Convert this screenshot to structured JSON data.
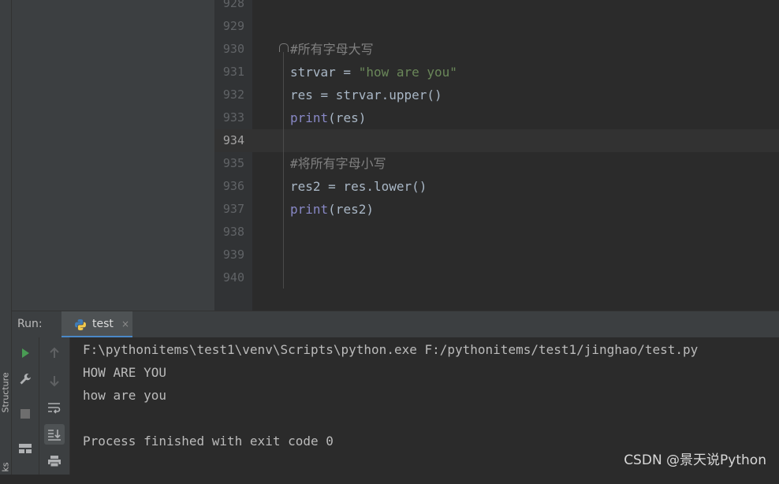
{
  "sidebar": {
    "structure_label": "Structure",
    "bookmarks_label": "ks"
  },
  "editor": {
    "lines": [
      {
        "num": "928",
        "tokens": []
      },
      {
        "num": "929",
        "tokens": []
      },
      {
        "num": "930",
        "tokens": [
          {
            "t": "#所有字母大写",
            "c": "comment"
          }
        ]
      },
      {
        "num": "931",
        "tokens": [
          {
            "t": "strvar = ",
            "c": ""
          },
          {
            "t": "\"how are you\"",
            "c": "kw-str"
          }
        ]
      },
      {
        "num": "932",
        "tokens": [
          {
            "t": "res = strvar.upper()",
            "c": ""
          }
        ]
      },
      {
        "num": "933",
        "tokens": [
          {
            "t": "print",
            "c": "kw-fn"
          },
          {
            "t": "(res)",
            "c": ""
          }
        ]
      },
      {
        "num": "934",
        "tokens": [],
        "current": true
      },
      {
        "num": "935",
        "tokens": [
          {
            "t": "#将所有字母小写",
            "c": "comment"
          }
        ]
      },
      {
        "num": "936",
        "tokens": [
          {
            "t": "res2 = res.lower()",
            "c": ""
          }
        ]
      },
      {
        "num": "937",
        "tokens": [
          {
            "t": "print",
            "c": "kw-fn"
          },
          {
            "t": "(res2)",
            "c": ""
          }
        ]
      },
      {
        "num": "938",
        "tokens": []
      },
      {
        "num": "939",
        "tokens": []
      },
      {
        "num": "940",
        "tokens": []
      }
    ]
  },
  "run": {
    "label": "Run:",
    "tab_title": "test",
    "close_glyph": "×",
    "console": [
      "F:\\pythonitems\\test1\\venv\\Scripts\\python.exe F:/pythonitems/test1/jinghao/test.py",
      "HOW ARE YOU",
      "how are you",
      "",
      "Process finished with exit code 0"
    ]
  },
  "watermark": "CSDN @景天说Python",
  "colors": {
    "accent": "#4a88c7",
    "run_green": "#499c54",
    "python_blue": "#3f7cb8",
    "python_yellow": "#f2c94c"
  }
}
